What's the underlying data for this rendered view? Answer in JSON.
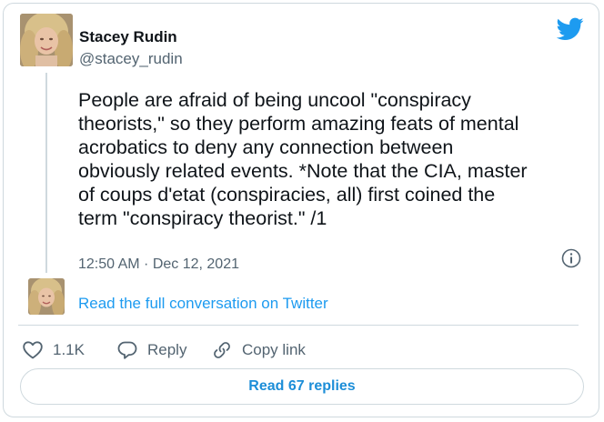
{
  "author": {
    "name": "Stacey Rudin",
    "handle": "@stacey_rudin"
  },
  "tweet": {
    "text": "People are afraid of being uncool \"conspiracy\ntheorists,\" so they perform amazing feats of mental\nacrobatics to deny any connection between\nobviously related events. *Note that the CIA, master\nof coups d'etat (conspiracies, all) first coined the\nterm \"conspiracy theorist.\" /1",
    "timestamp": "12:50 AM · Dec 12, 2021"
  },
  "conversation_link": "Read the full conversation on Twitter",
  "actions": {
    "like_count": "1.1K",
    "reply_label": "Reply",
    "copy_link_label": "Copy link"
  },
  "read_replies_label": "Read 67 replies",
  "icons": {
    "brand": "twitter-bird-icon",
    "info": "info-icon",
    "like": "heart-icon",
    "reply": "speech-bubble-icon",
    "copy": "link-icon"
  },
  "colors": {
    "brand_blue": "#1d9bf0",
    "secondary_text": "#536471",
    "border": "#cfd9de"
  }
}
